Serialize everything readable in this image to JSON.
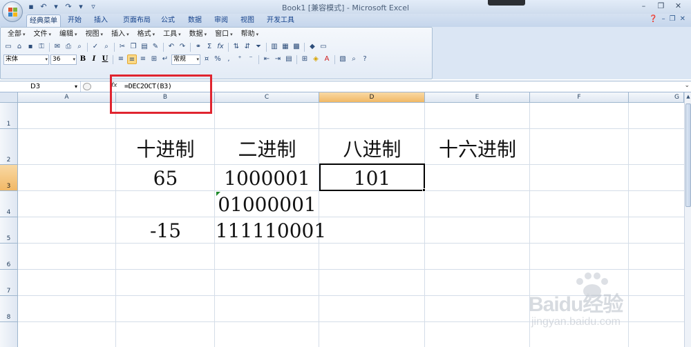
{
  "window": {
    "title": "Book1  [兼容模式] - Microsoft Excel",
    "minimize": "–",
    "maximize": "❐",
    "close": "✕"
  },
  "tabs": [
    "经典菜单",
    "开始",
    "插入",
    "页面布局",
    "公式",
    "数据",
    "审阅",
    "视图",
    "开发工具"
  ],
  "menus": [
    "全部",
    "文件",
    "编辑",
    "视图",
    "插入",
    "格式",
    "工具",
    "数据",
    "窗口",
    "帮助"
  ],
  "toolbar": {
    "font_name": "宋体",
    "font_size": "36",
    "bold": "B",
    "italic": "I",
    "underline": "U",
    "number_format": "常规",
    "percent": "%",
    "comma": ",",
    "sum": "Σ",
    "fx": "fx"
  },
  "formula_bar": {
    "name_box": "D3",
    "fx_label": "fx",
    "formula": "=DEC2OCT(B3)"
  },
  "columns": [
    "A",
    "B",
    "C",
    "D",
    "E",
    "F",
    "G"
  ],
  "rows": [
    "1",
    "2",
    "3",
    "4",
    "5",
    "6",
    "7",
    "8"
  ],
  "cells": {
    "B2": "十进制",
    "C2": "二进制",
    "D2": "八进制",
    "E2": "十六进制",
    "B3": "65",
    "C3": "1000001",
    "D3": "101",
    "C4": "01000001",
    "B5": "-15",
    "C5": "111110001"
  },
  "colors": {
    "highlight": "#e0242f",
    "selected_header": "#f1b866"
  },
  "watermark": {
    "brand": "Baidu经验",
    "sub": "jingyan.baidu.com"
  }
}
